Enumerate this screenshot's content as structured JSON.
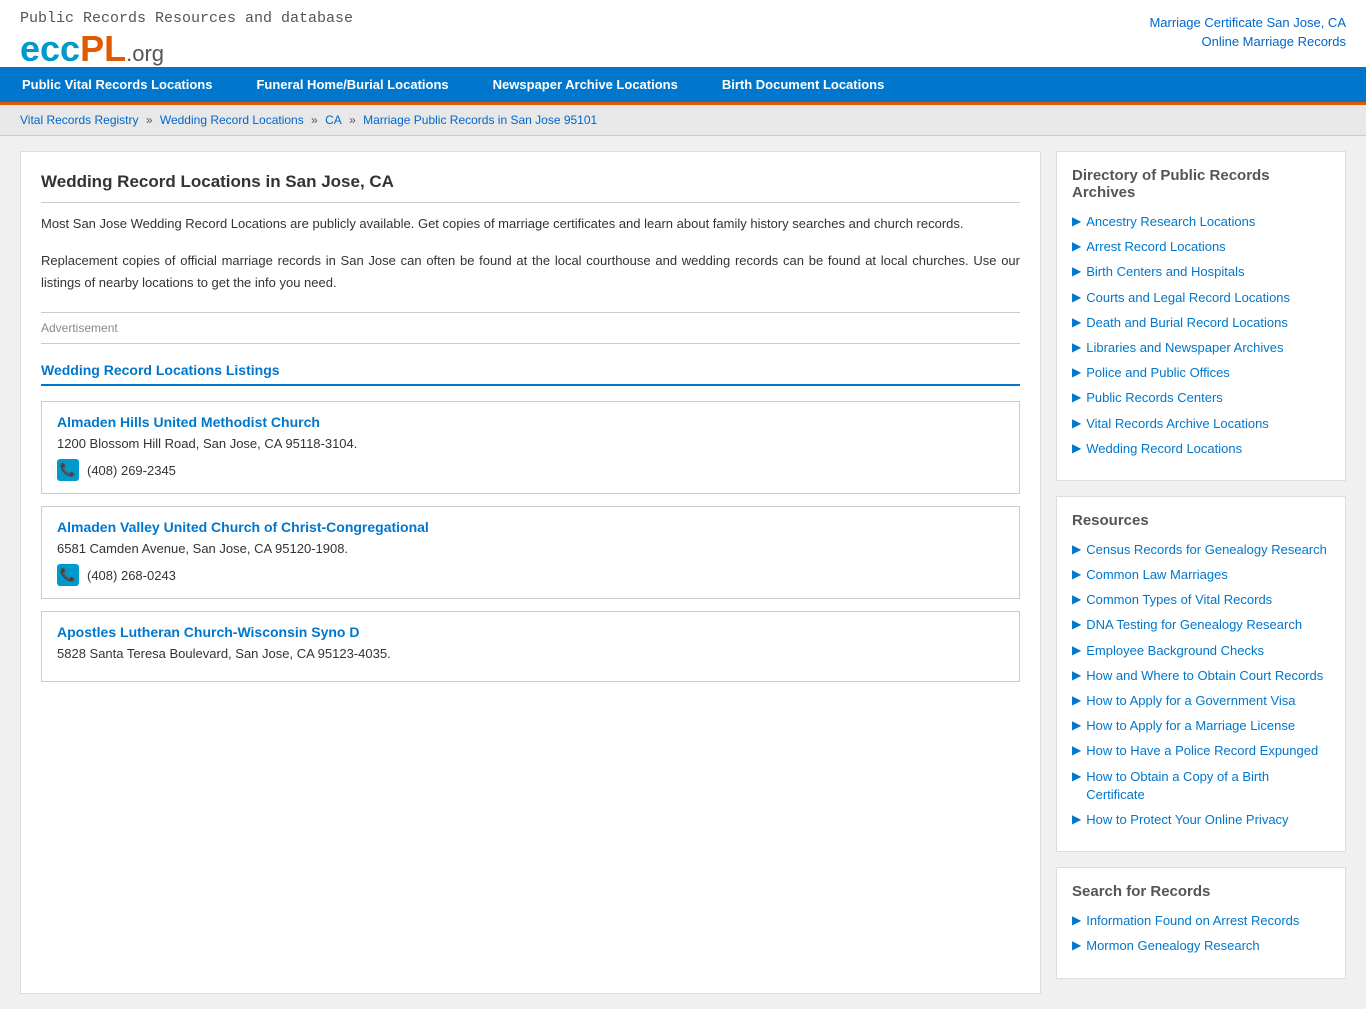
{
  "header": {
    "tagline": "Public Records Resources and database",
    "logo_ecc": "ecc",
    "logo_pl": "PL",
    "logo_org": ".org",
    "links": [
      {
        "text": "Marriage Certificate San Jose, CA",
        "href": "#"
      },
      {
        "text": "Online Marriage Records",
        "href": "#"
      }
    ]
  },
  "navbar": {
    "items": [
      {
        "label": "Public Vital Records Locations",
        "href": "#"
      },
      {
        "label": "Funeral Home/Burial Locations",
        "href": "#"
      },
      {
        "label": "Newspaper Archive Locations",
        "href": "#"
      },
      {
        "label": "Birth Document Locations",
        "href": "#"
      }
    ]
  },
  "breadcrumb": {
    "items": [
      {
        "text": "Vital Records Registry",
        "href": "#"
      },
      {
        "text": "Wedding Record Locations",
        "href": "#"
      },
      {
        "text": "CA",
        "href": "#"
      },
      {
        "text": "Marriage Public Records in San Jose 95101",
        "href": "#"
      }
    ]
  },
  "content": {
    "title": "Wedding Record Locations in San Jose, CA",
    "desc1": "Most San Jose Wedding Record Locations are publicly available. Get copies of marriage certificates and learn about family history searches and church records.",
    "desc2": "Replacement copies of official marriage records in San Jose can often be found at the local courthouse and wedding records can be found at local churches. Use our listings of nearby locations to get the info you need.",
    "ad_label": "Advertisement",
    "listings_title": "Wedding Record Locations Listings",
    "listings": [
      {
        "name": "Almaden Hills United Methodist Church",
        "address": "1200 Blossom Hill Road, San Jose, CA 95118-3104.",
        "phone": "(408) 269-2345"
      },
      {
        "name": "Almaden Valley United Church of Christ-Congregational",
        "address": "6581 Camden Avenue, San Jose, CA 95120-1908.",
        "phone": "(408) 268-0243"
      },
      {
        "name": "Apostles Lutheran Church-Wisconsin Syno D",
        "address": "5828 Santa Teresa Boulevard, San Jose, CA 95123-4035.",
        "phone": ""
      }
    ]
  },
  "sidebar": {
    "directory_title": "Directory of Public Records Archives",
    "directory_links": [
      "Ancestry Research Locations",
      "Arrest Record Locations",
      "Birth Centers and Hospitals",
      "Courts and Legal Record Locations",
      "Death and Burial Record Locations",
      "Libraries and Newspaper Archives",
      "Police and Public Offices",
      "Public Records Centers",
      "Vital Records Archive Locations",
      "Wedding Record Locations"
    ],
    "resources_title": "Resources",
    "resources_links": [
      "Census Records for Genealogy Research",
      "Common Law Marriages",
      "Common Types of Vital Records",
      "DNA Testing for Genealogy Research",
      "Employee Background Checks",
      "How and Where to Obtain Court Records",
      "How to Apply for a Government Visa",
      "How to Apply for a Marriage License",
      "How to Have a Police Record Expunged",
      "How to Obtain a Copy of a Birth Certificate",
      "How to Protect Your Online Privacy"
    ],
    "search_title": "Search for Records",
    "search_links": [
      "Information Found on Arrest Records",
      "Mormon Genealogy Research"
    ]
  }
}
